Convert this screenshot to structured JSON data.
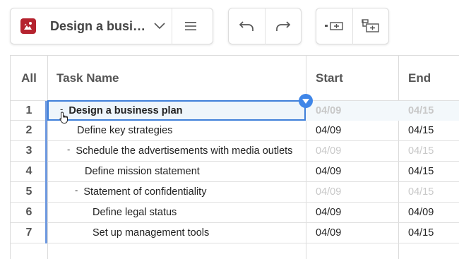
{
  "toolbar": {
    "doc_title": "Design a busin...",
    "logo_icon": "app-logo-icon",
    "chevron_icon": "chevron-down-icon",
    "menu_icon": "hamburger-menu-icon",
    "undo_icon": "undo-icon",
    "redo_icon": "redo-icon",
    "indent_icon": "indent-task-icon",
    "add_subtask_icon": "add-subtask-icon",
    "brand_color": "#b5232f"
  },
  "grid": {
    "headers": {
      "all": "All",
      "task_name": "Task Name",
      "start": "Start",
      "end": "End"
    },
    "rows": [
      {
        "num": "1",
        "task": "Design a business plan",
        "start": "04/09",
        "end": "04/15",
        "collapse": "-",
        "level": 0,
        "summary": true
      },
      {
        "num": "2",
        "task": "Define key strategies",
        "start": "04/09",
        "end": "04/15",
        "collapse": "",
        "level": 1,
        "summary": false
      },
      {
        "num": "3",
        "task": "Schedule the advertisements with media outlets",
        "start": "04/09",
        "end": "04/15",
        "collapse": "-",
        "level": 1,
        "summary": true
      },
      {
        "num": "4",
        "task": "Define mission statement",
        "start": "04/09",
        "end": "04/15",
        "collapse": "",
        "level": 2,
        "summary": false
      },
      {
        "num": "5",
        "task": "Statement of confidentiality",
        "start": "04/09",
        "end": "04/15",
        "collapse": "-",
        "level": 2,
        "summary": true
      },
      {
        "num": "6",
        "task": "Define legal status",
        "start": "04/09",
        "end": "04/09",
        "collapse": "",
        "level": 3,
        "summary": false
      },
      {
        "num": "7",
        "task": "Set up management tools",
        "start": "04/09",
        "end": "04/15",
        "collapse": "",
        "level": 3,
        "summary": false
      }
    ],
    "selected_row": 0,
    "selection_color": "#3f7fd9"
  }
}
